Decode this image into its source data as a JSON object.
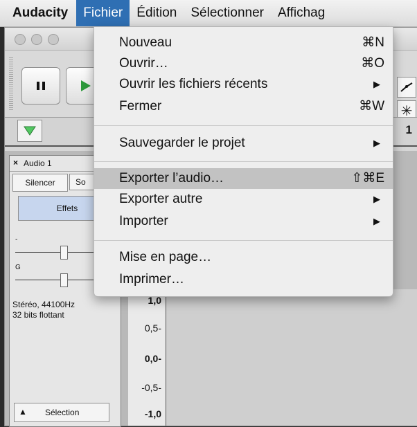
{
  "menubar": {
    "app": "Audacity",
    "items": [
      "Fichier",
      "Édition",
      "Sélectionner",
      "Affichag"
    ]
  },
  "fichier_menu": {
    "items": [
      {
        "label": "Nouveau",
        "shortcut": "⌘N"
      },
      {
        "label": "Ouvrir…",
        "shortcut": "⌘O"
      },
      {
        "label": "Ouvrir les fichiers récents",
        "submenu": "▶"
      },
      {
        "label": "Fermer",
        "shortcut": "⌘W"
      },
      {
        "label": "Sauvegarder le projet",
        "submenu": "▶"
      },
      {
        "label": "Exporter l’audio…",
        "shortcut": "⇧⌘E"
      },
      {
        "label": "Exporter autre",
        "submenu": "▶"
      },
      {
        "label": "Importer",
        "submenu": "▶"
      },
      {
        "label": "Mise en page…"
      },
      {
        "label": "Imprimer…"
      }
    ],
    "highlighted": "Exporter l’audio…"
  },
  "toolbar": {
    "pause_icon": "pause-icon",
    "play_icon": "play-icon",
    "envelope_tool_icon": "envelope-tool-icon",
    "multi_tool_icon": "multi-tool-icon",
    "green_triangle_icon": "triangle-down-icon",
    "partial_number": "1"
  },
  "track": {
    "close": "×",
    "name": "Audio 1",
    "mute": "Silencer",
    "solo": "So",
    "effects": "Effets",
    "gain_min": "-",
    "pan_label": "G",
    "format": "Stéréo, 44100Hz",
    "bits": "32 bits flottant",
    "select_icon": "▲",
    "select": "Sélection",
    "scale": [
      "1,0",
      "0,5-",
      "0,0-",
      "-0,5-",
      "-1,0"
    ]
  },
  "colors": {
    "menu_highlight_blue": "#2f6fb3",
    "effects_button": "#c7d6ee",
    "play_green": "#2e9a3c"
  }
}
